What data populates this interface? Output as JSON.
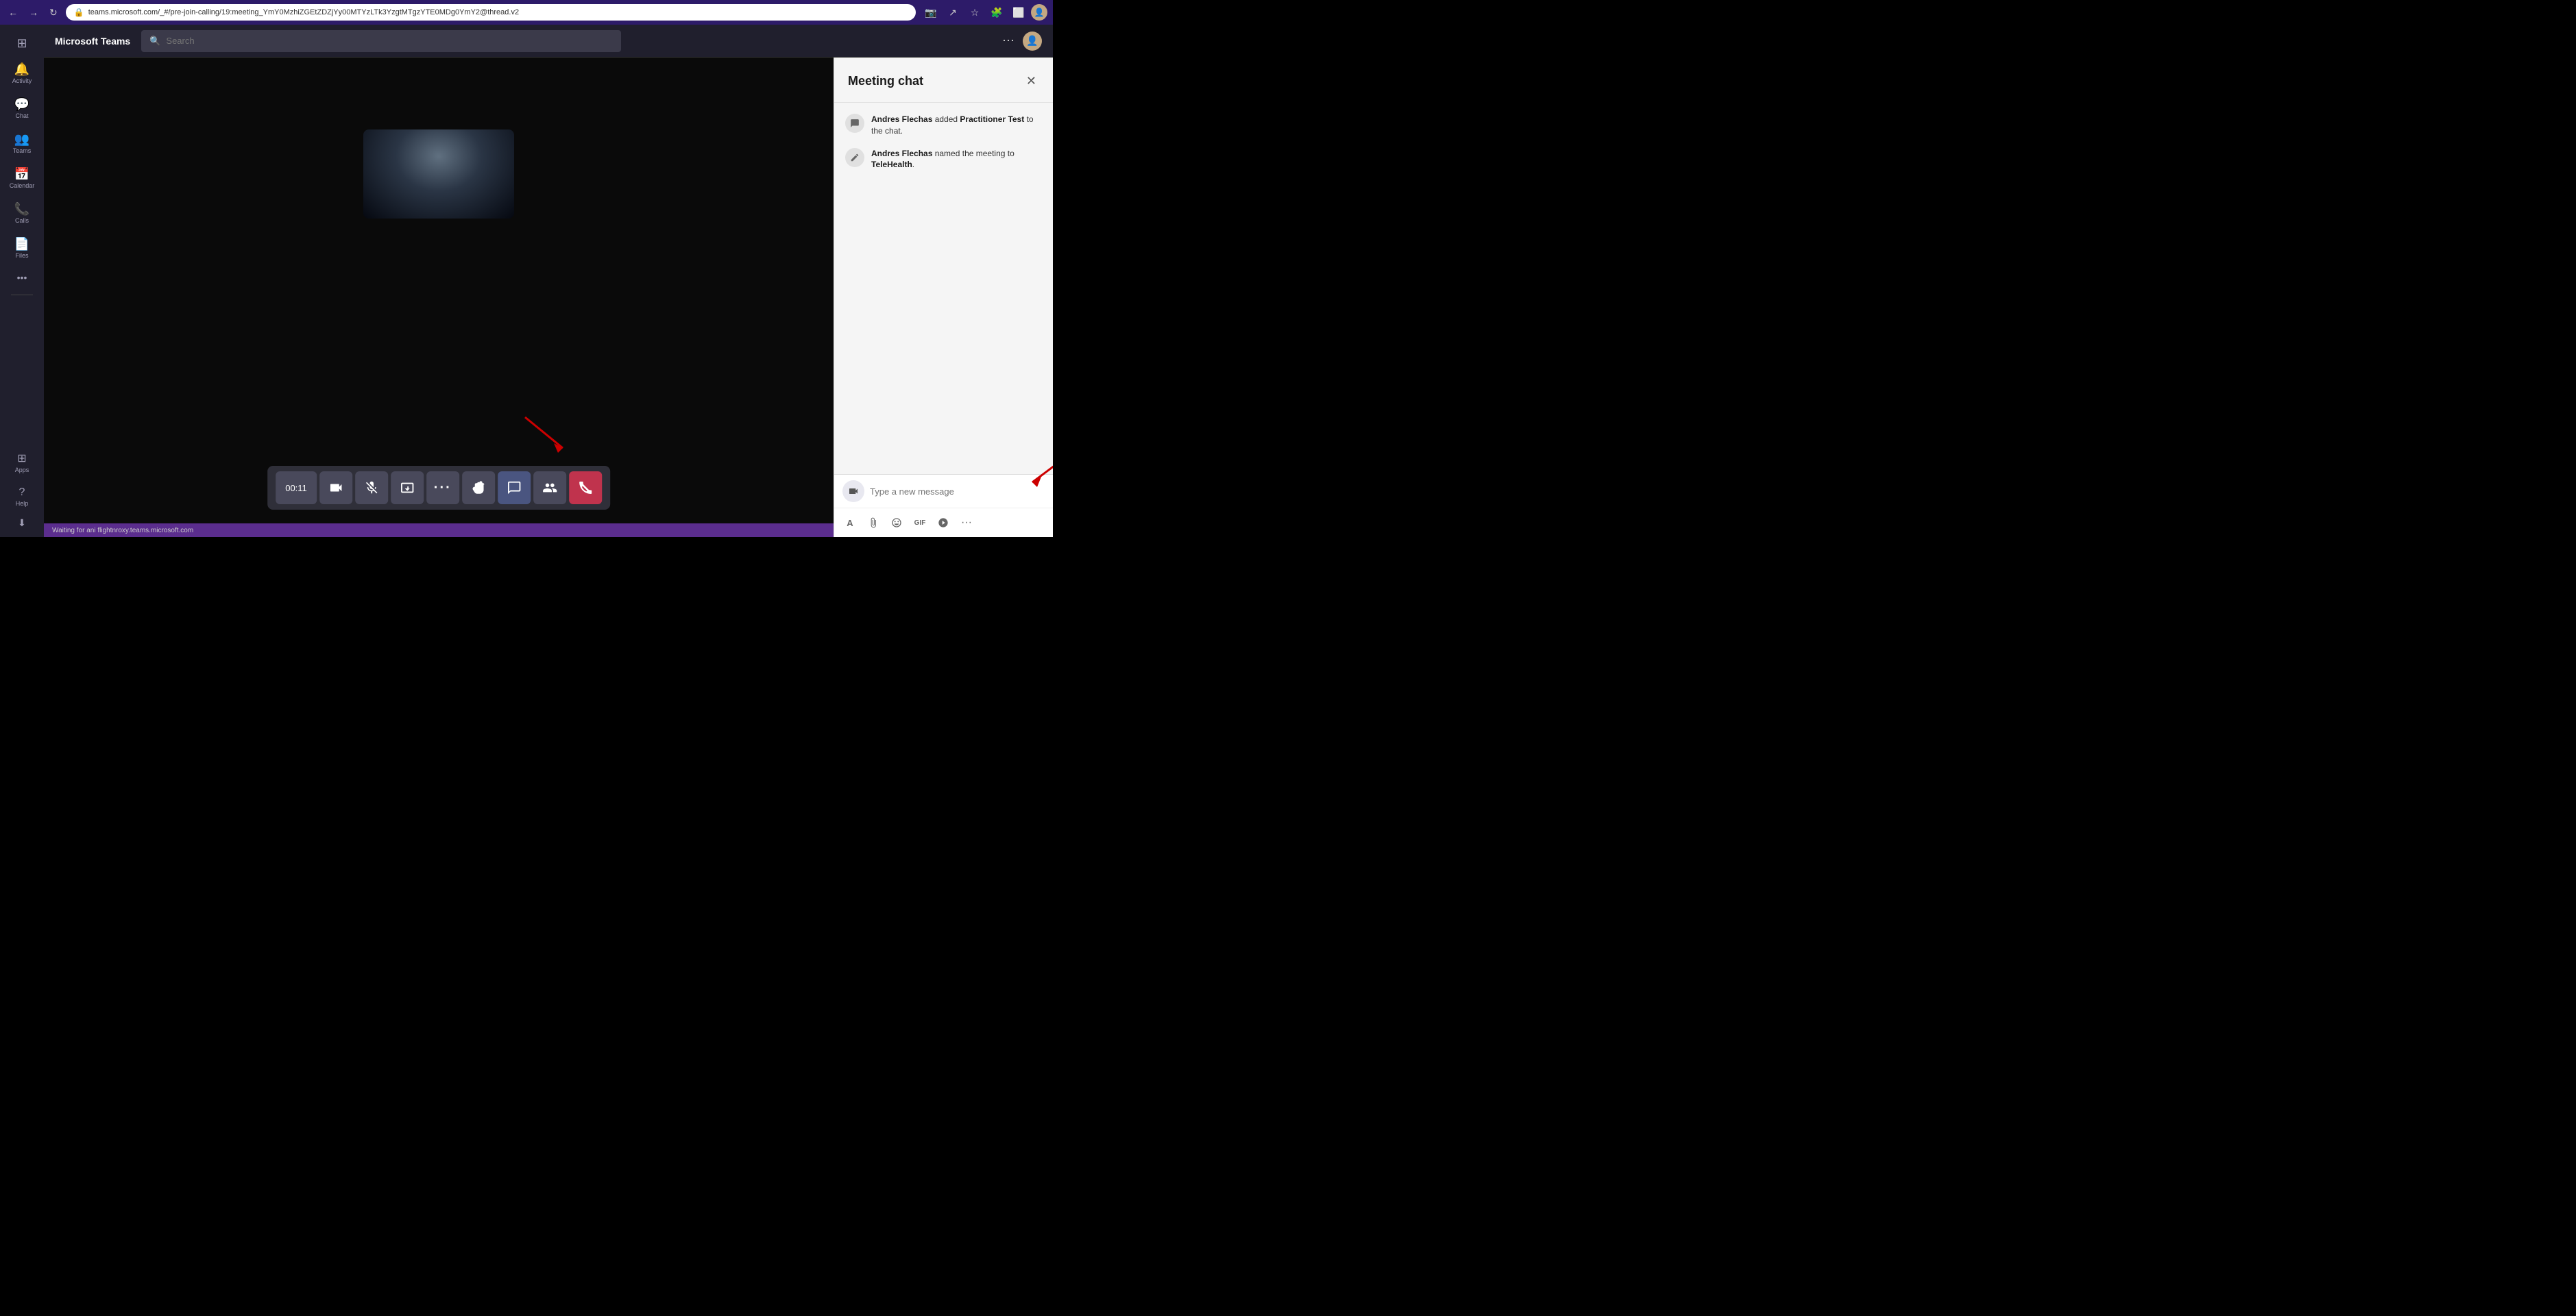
{
  "browser": {
    "back_label": "←",
    "forward_label": "→",
    "refresh_label": "↻",
    "url": "teams.microsoft.com/_#/pre-join-calling/19:meeting_YmY0MzhiZGEtZDZjYy00MTYzLTk3YzgtMTgzYTE0MDg0YmY2@thread.v2",
    "more_label": "⋯"
  },
  "header": {
    "app_name": "Microsoft Teams",
    "search_placeholder": "Search",
    "more_btn": "⋯"
  },
  "sidebar": {
    "items": [
      {
        "id": "activity",
        "label": "Activity",
        "icon": "🔔"
      },
      {
        "id": "chat",
        "label": "Chat",
        "icon": "💬"
      },
      {
        "id": "teams",
        "label": "Teams",
        "icon": "👥"
      },
      {
        "id": "calendar",
        "label": "Calendar",
        "icon": "📅"
      },
      {
        "id": "calls",
        "label": "Calls",
        "icon": "📞"
      },
      {
        "id": "files",
        "label": "Files",
        "icon": "📄"
      }
    ],
    "more_label": "•••",
    "bottom_items": [
      {
        "id": "apps",
        "label": "Apps",
        "icon": "⊞"
      },
      {
        "id": "help",
        "label": "Help",
        "icon": "?"
      }
    ]
  },
  "video": {
    "timer": "00:11"
  },
  "controls": [
    {
      "id": "timer-display",
      "label": "00:11",
      "type": "timer"
    },
    {
      "id": "camera",
      "label": "📷",
      "icon": "camera-icon"
    },
    {
      "id": "mute",
      "label": "🎤",
      "icon": "mute-icon",
      "active": false
    },
    {
      "id": "share",
      "label": "⬆",
      "icon": "share-icon"
    },
    {
      "id": "more",
      "label": "•••",
      "icon": "more-icon"
    },
    {
      "id": "raise-hand",
      "label": "✋",
      "icon": "raise-hand-icon"
    },
    {
      "id": "chat",
      "label": "💬",
      "icon": "chat-icon",
      "active": true
    },
    {
      "id": "participants",
      "label": "👤",
      "icon": "participants-icon"
    },
    {
      "id": "end-call",
      "label": "📵",
      "icon": "end-call-icon",
      "type": "end-call"
    }
  ],
  "waiting_bar": {
    "text": "Waiting for ani flightnroxy.teams.microsoft.com"
  },
  "chat_panel": {
    "title": "Meeting chat",
    "close_label": "✕",
    "events": [
      {
        "id": "event1",
        "icon": "💬",
        "text_parts": [
          {
            "bold": true,
            "text": "Andres Flechas"
          },
          {
            "bold": false,
            "text": " added "
          },
          {
            "bold": true,
            "text": "Practitioner Test"
          },
          {
            "bold": false,
            "text": " to the chat."
          }
        ],
        "full_text": "Andres Flechas added Practitioner Test to the chat."
      },
      {
        "id": "event2",
        "icon": "✏",
        "text_parts": [
          {
            "bold": true,
            "text": "Andres Flechas"
          },
          {
            "bold": false,
            "text": " named the meeting to "
          },
          {
            "bold": true,
            "text": "TeleHealth"
          },
          {
            "bold": false,
            "text": "."
          }
        ],
        "full_text": "Andres Flechas named the meeting to TeleHealth."
      }
    ],
    "input": {
      "placeholder": "Type a new message",
      "video_icon": "📹"
    },
    "toolbar": {
      "format_icon": "A",
      "attach_icon": "📎",
      "emoji_icon": "😊",
      "gif_icon": "GIF",
      "sticker_icon": "⭐",
      "more_icon": "•••"
    }
  },
  "colors": {
    "sidebar_bg": "#201f2d",
    "header_bg": "#201f2d",
    "video_bg": "#0a0a0a",
    "chat_bg": "#f5f5f5",
    "accent_purple": "#5b2d8e",
    "end_call_red": "#c0334d",
    "active_blue": "#4a5580"
  }
}
